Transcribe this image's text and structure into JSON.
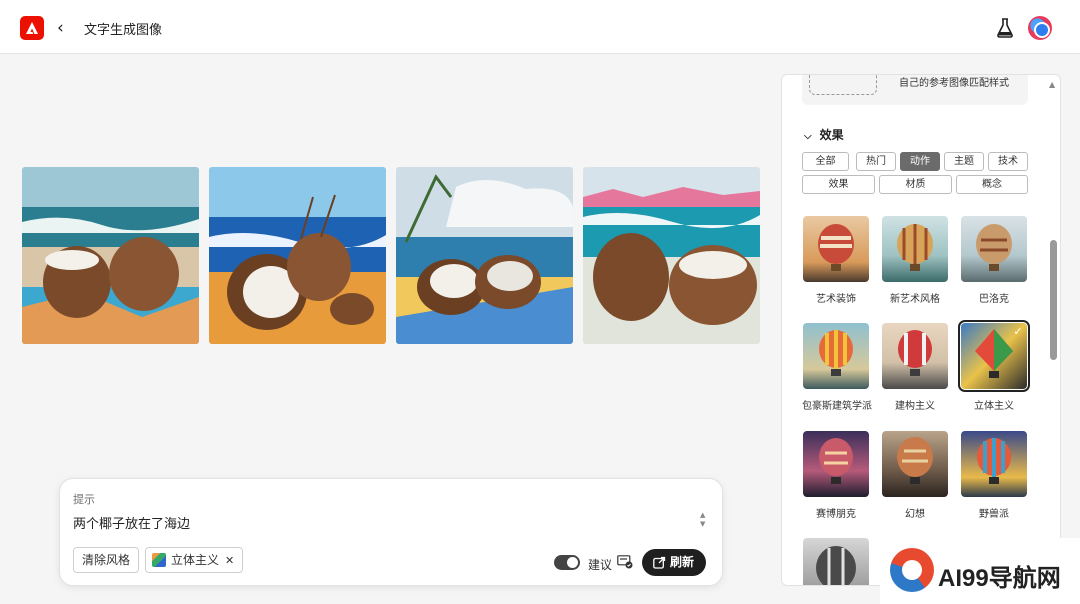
{
  "header": {
    "title": "文字生成图像",
    "back_icon": "chevron-left-icon",
    "lab_icon": "flask-icon"
  },
  "gallery": {
    "images": [
      {
        "alt": "coconut-beach-1"
      },
      {
        "alt": "coconut-beach-2"
      },
      {
        "alt": "coconut-beach-3"
      },
      {
        "alt": "coconut-beach-4"
      }
    ]
  },
  "prompt": {
    "label": "提示",
    "text": "两个椰子放在了海边",
    "clear_style": "清除风格",
    "style_chip": "立体主义",
    "suggest_label": "建议",
    "refresh_label": "刷新"
  },
  "panel": {
    "ref_text": "自己的参考图像匹配样式",
    "effects_heading": "效果",
    "tags_row1": [
      "全部",
      "热门",
      "动作",
      "主题",
      "技术"
    ],
    "tags_row2": [
      "效果",
      "材质",
      "概念"
    ],
    "active_tag": "动作",
    "styles": [
      "艺术装饰",
      "新艺术风格",
      "巴洛克",
      "包豪斯建筑学派",
      "建构主义",
      "立体主义",
      "赛博朋克",
      "幻想",
      "野兽派"
    ],
    "selected_style": "立体主义"
  },
  "watermark": {
    "text": "AI99导航网"
  },
  "colors": {
    "brand": "#eb1000",
    "refresh_bg": "#1f1f1f"
  }
}
